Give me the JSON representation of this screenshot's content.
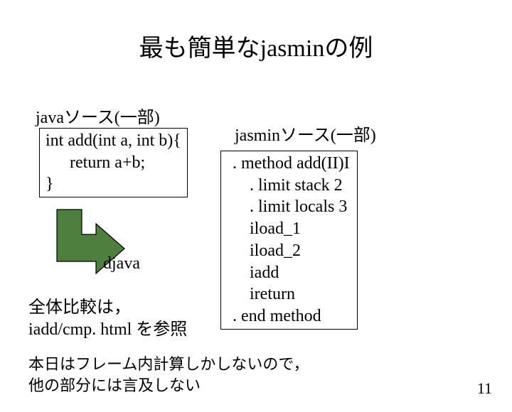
{
  "title": "最も簡単なjasminの例",
  "java": {
    "label": "javaソース(一部)",
    "lines": {
      "l0": "int add(int a, int b){",
      "l1": "return a+b;",
      "l2": "}"
    }
  },
  "djava": "djava",
  "jasmin": {
    "label": "jasminソース(一部)",
    "lines": {
      "l0": ". method add(II)I",
      "l1": ". limit stack 2",
      "l2": ". limit locals 3",
      "l3": "iload_1",
      "l4": "iload_2",
      "l5": "iadd",
      "l6": "ireturn",
      "l7": ". end method"
    }
  },
  "ref": {
    "l0": "全体比較は，",
    "l1": "iadd/cmp. html を参照"
  },
  "bottom": {
    "l0": "本日はフレーム内計算しかしないので，",
    "l1": "他の部分には言及しない"
  },
  "page": "11"
}
